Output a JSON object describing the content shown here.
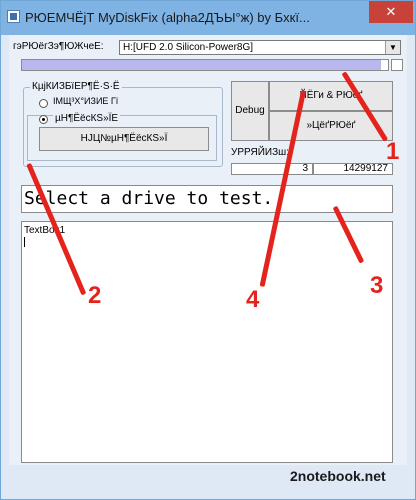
{
  "window": {
    "title": "РЮЕМЧЁјТ MyDiskFix (alpha2ДЪЫ°ж) by Бхкї...",
    "close_glyph": "✕"
  },
  "drive": {
    "label": "гэРЮёгЗэ¶ЮЖчеЕ:",
    "selected": "H:[UFD 2.0 Silicon-Power8G]"
  },
  "progress": {
    "fraction": 0.98
  },
  "scan_group": {
    "title": "КµјКИЗБїЕР¶Ё·Ѕ·Ё",
    "option1": "ІМЩ³Х°ИЗИЕ Гї",
    "option2": "µН¶ЁёсКЅ»ЇЕ",
    "button_label": "НЈЦ№µН¶ЁёсКЅ»Ї"
  },
  "buttons": {
    "debug": "Debug",
    "start": "ЙЁГи & РЮёґ",
    "restore": "»ЦёґРЮёґ"
  },
  "stats": {
    "label": "УРРЯЙИЗш:",
    "value1": "3",
    "value2": "14299127"
  },
  "status_text": "Select a drive to test.",
  "log_text": "TextBox1",
  "annotations": [
    "1",
    "2",
    "3",
    "4"
  ],
  "watermark": "2notebook.net",
  "colors": {
    "arrow": "#e5231d",
    "titlebar": "#7fb3e4",
    "progress": "#b8b8ee"
  }
}
